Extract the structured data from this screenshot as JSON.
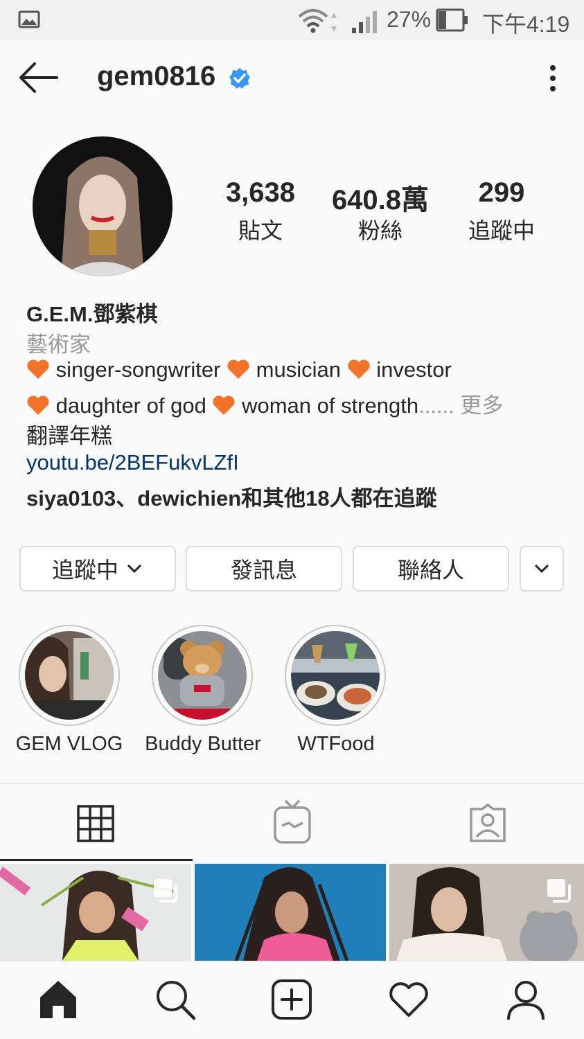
{
  "status_bar": {
    "battery": "27%",
    "time": "下午4:19"
  },
  "header": {
    "username": "gem0816"
  },
  "stats": [
    {
      "count": "3,638",
      "label": "貼文"
    },
    {
      "count": "640.8萬",
      "label": "粉絲"
    },
    {
      "count": "299",
      "label": "追蹤中"
    }
  ],
  "bio": {
    "name": "G.E.M.鄧紫棋",
    "category": "藝術家",
    "tag1": "singer-songwriter",
    "tag2": "musician",
    "tag3": "investor",
    "tag4": "daughter of god",
    "tag5": "woman of strength",
    "ellipsis": "......",
    "more": "更多",
    "translate": "翻譯年糕",
    "link": "youtu.be/2BEFukvLZfI",
    "followed_by": "siya0103、dewichien和其他18人都在追蹤"
  },
  "buttons": {
    "following": "追蹤中",
    "message": "發訊息",
    "contact": "聯絡人"
  },
  "highlights": [
    {
      "label": "GEM VLOG"
    },
    {
      "label": "Buddy Butter"
    },
    {
      "label": "WTFood"
    }
  ],
  "colors": {
    "verified": "#3897f0",
    "heart": "#f4732a",
    "link": "#003569",
    "active_tab": "#262626"
  }
}
